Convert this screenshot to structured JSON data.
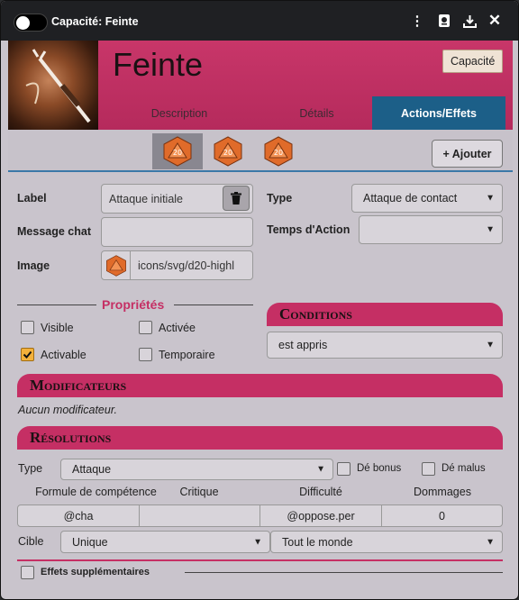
{
  "window": {
    "title": "Capacité: Feinte"
  },
  "titlebar_icons": [
    "toggle-switch",
    "more-vertical-icon",
    "id-card-icon",
    "download-icon",
    "close-icon"
  ],
  "header": {
    "name": "Feinte",
    "type_badge": "Capacité"
  },
  "tabs": [
    {
      "label": "Description",
      "active": false
    },
    {
      "label": "Détails",
      "active": false
    },
    {
      "label": "Actions/Effets",
      "active": true
    }
  ],
  "effects": {
    "add_label": "+ Ajouter"
  },
  "form": {
    "label_label": "Label",
    "label_value": "Attaque initiale",
    "message_label": "Message chat",
    "message_value": "",
    "image_label": "Image",
    "image_value": "icons/svg/d20-highl",
    "type_label": "Type",
    "type_value": "Attaque de contact",
    "time_label": "Temps d'Action",
    "time_value": ""
  },
  "properties": {
    "title": "Propriétés",
    "items": [
      {
        "label": "Visible",
        "checked": false
      },
      {
        "label": "Activée",
        "checked": false
      },
      {
        "label": "Activable",
        "checked": true
      },
      {
        "label": "Temporaire",
        "checked": false
      }
    ]
  },
  "conditions": {
    "title": "Conditions",
    "value": "est appris"
  },
  "modifiers": {
    "title": "Modificateurs",
    "empty_text": "Aucun modificateur."
  },
  "resolutions": {
    "title": "Résolutions",
    "type_label": "Type",
    "type_value": "Attaque",
    "bonus_label": "Dé bonus",
    "malus_label": "Dé malus",
    "columns": [
      "Formule de compétence",
      "Critique",
      "Difficulté",
      "Dommages"
    ],
    "values": [
      "@cha",
      "",
      "@oppose.per",
      "0"
    ],
    "target_label": "Cible",
    "target_value": "Unique",
    "target_scope": "Tout le monde",
    "extra_label": "Effets supplémentaires"
  },
  "colors": {
    "accent": "#c52f64",
    "tab_active": "#1c5f88",
    "check": "#f3b13b"
  }
}
